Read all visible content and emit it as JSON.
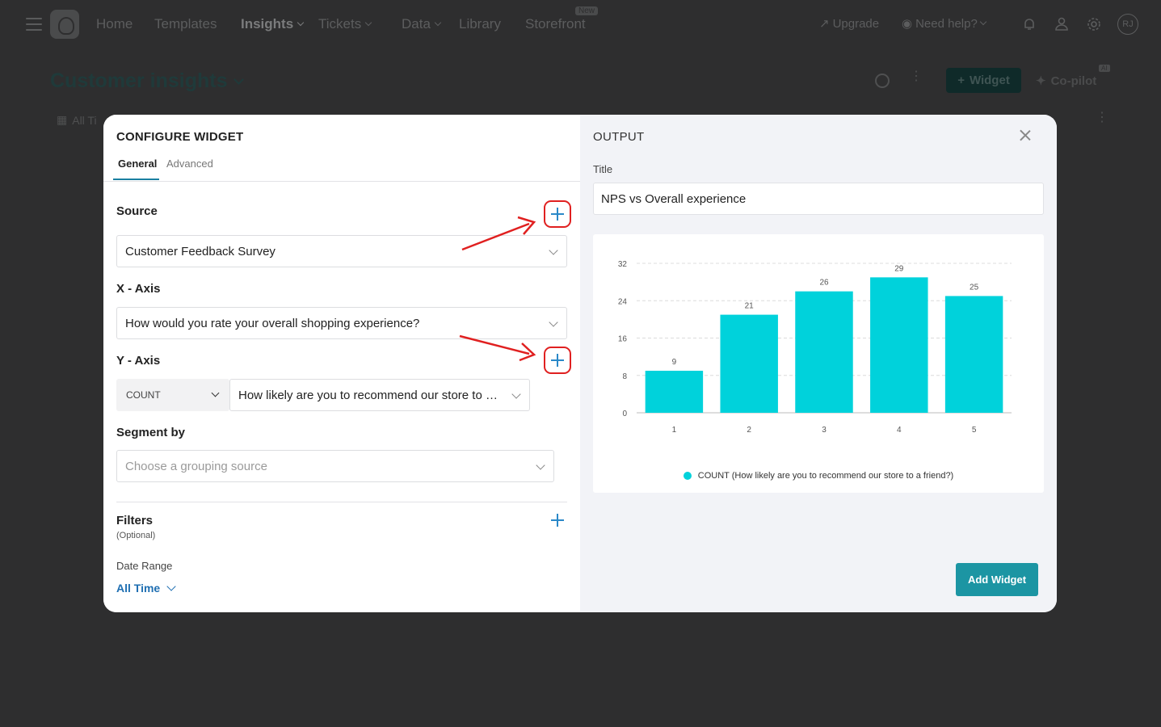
{
  "topnav": {
    "items": [
      {
        "label": "Home"
      },
      {
        "label": "Templates"
      },
      {
        "label": "Insights"
      },
      {
        "label": "Tickets"
      },
      {
        "label": "Data"
      },
      {
        "label": "Library"
      },
      {
        "label": "Storefront"
      }
    ],
    "new_badge": "New",
    "upgrade": "Upgrade",
    "help": "Need help?",
    "avatar_initials": "RJ"
  },
  "page": {
    "title": "Customer insights",
    "widget_button": "Widget",
    "copilot": "Co-pilot",
    "ai_badge": "AI",
    "time_filter": "All Ti"
  },
  "configure": {
    "title": "CONFIGURE WIDGET",
    "tabs": [
      "General",
      "Advanced"
    ],
    "active_tab": "General",
    "source_label": "Source",
    "source_value": "Customer Feedback Survey",
    "x_label": "X - Axis",
    "x_value": "How would you rate your overall shopping experience?",
    "y_label": "Y - Axis",
    "y_aggregate": "COUNT",
    "y_value": "How likely are you to recommend our store to a friend?",
    "segment_label": "Segment by",
    "segment_placeholder": "Choose a grouping source",
    "filters_label": "Filters",
    "filters_optional": "(Optional)",
    "date_range_label": "Date Range",
    "date_range_value": "All Time"
  },
  "output": {
    "title": "OUTPUT",
    "title_field_label": "Title",
    "title_field_value": "NPS vs Overall experience",
    "add_button": "Add Widget"
  },
  "colors": {
    "bar": "#00d2db",
    "accent": "#1c95a3",
    "annotation": "#e02020"
  },
  "chart_data": {
    "type": "bar",
    "categories": [
      "1",
      "2",
      "3",
      "4",
      "5"
    ],
    "values": [
      9,
      21,
      26,
      29,
      25
    ],
    "ylim": [
      0,
      32
    ],
    "yticks": [
      0,
      8,
      16,
      24,
      32
    ],
    "grid": true,
    "data_labels": true,
    "legend_position": "bottom",
    "series": [
      {
        "name": "COUNT (How likely are you to recommend our store to a friend?)",
        "values": [
          9,
          21,
          26,
          29,
          25
        ]
      }
    ]
  }
}
